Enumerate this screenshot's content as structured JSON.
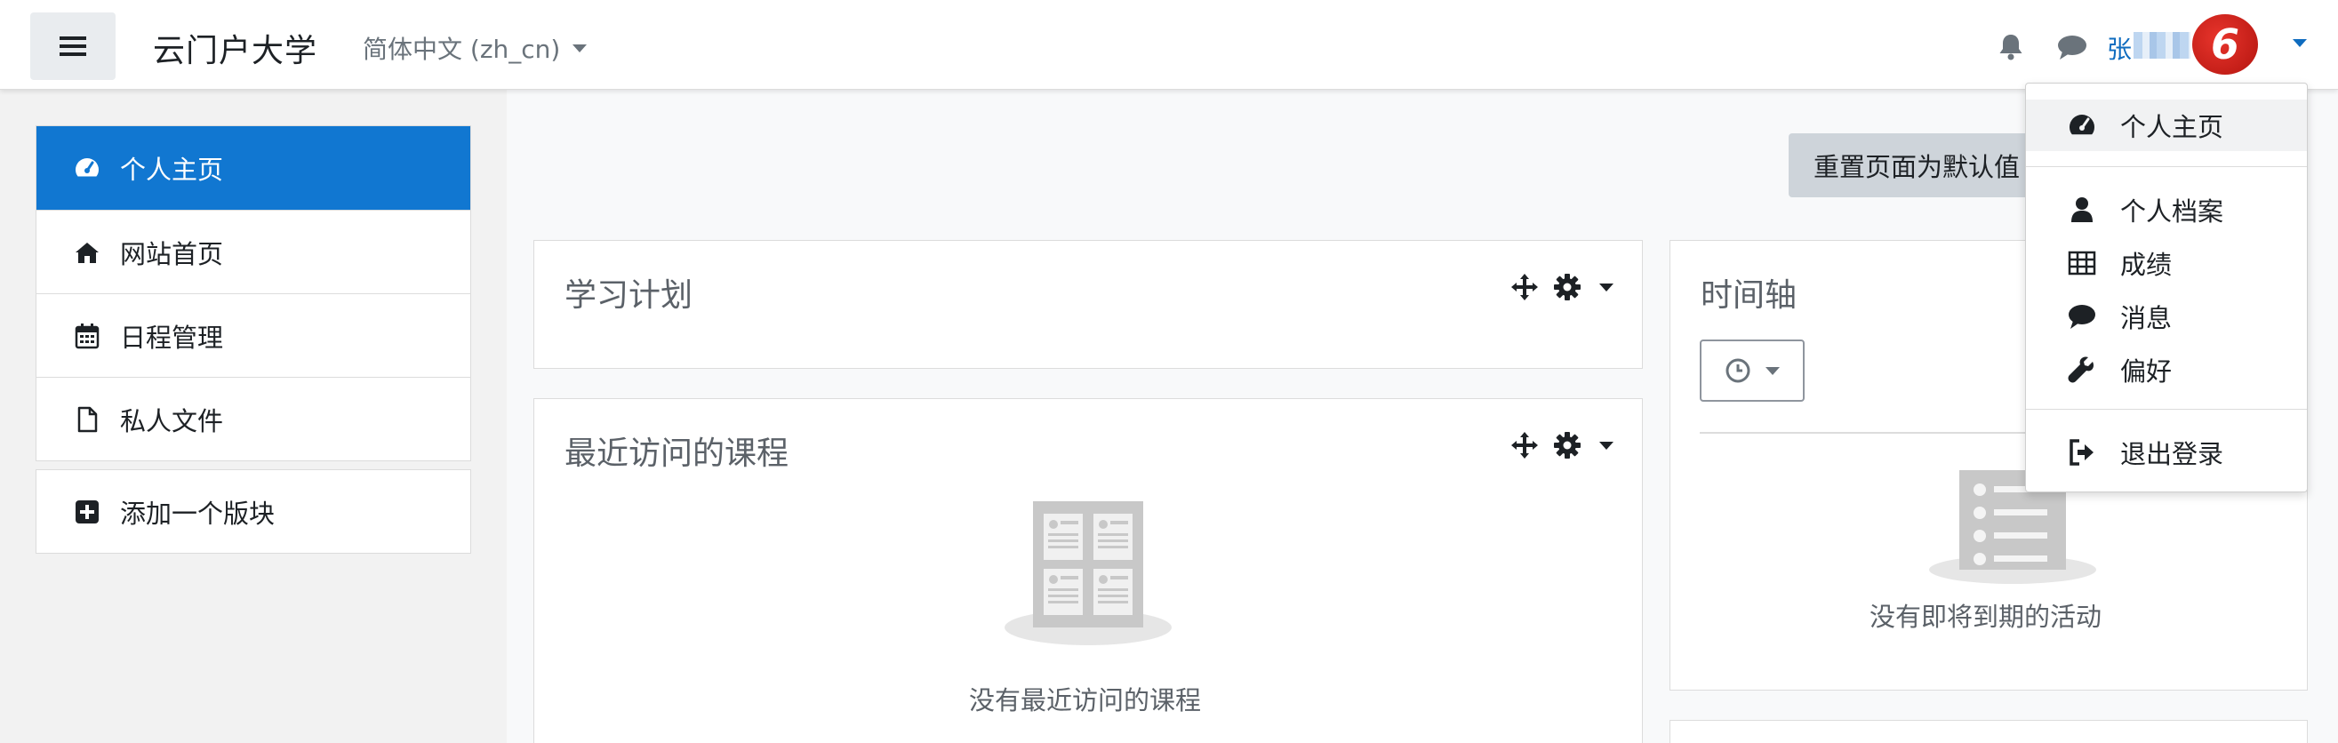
{
  "navbar": {
    "site_name": "云门户大学",
    "language": "简体中文 (zh_cn)",
    "username": "张",
    "avatar_mark": "6"
  },
  "sidebar": {
    "items": [
      {
        "label": "个人主页",
        "icon": "dashboard-icon",
        "active": true
      },
      {
        "label": "网站首页",
        "icon": "home-icon",
        "active": false
      },
      {
        "label": "日程管理",
        "icon": "calendar-icon",
        "active": false
      },
      {
        "label": "私人文件",
        "icon": "file-icon",
        "active": false
      }
    ],
    "add_block_label": "添加一个版块"
  },
  "main": {
    "reset_button_label": "重置页面为默认值",
    "blocks": {
      "study_plan": {
        "title": "学习计划"
      },
      "recent_courses": {
        "title": "最近访问的课程",
        "empty_text": "没有最近访问的课程"
      },
      "timeline": {
        "title": "时间轴",
        "empty_text": "没有即将到期的活动"
      }
    }
  },
  "user_menu": {
    "items": [
      {
        "label": "个人主页",
        "icon": "dashboard-icon"
      },
      {
        "label": "个人档案",
        "icon": "user-icon"
      },
      {
        "label": "成绩",
        "icon": "table-icon"
      },
      {
        "label": "消息",
        "icon": "comment-icon"
      },
      {
        "label": "偏好",
        "icon": "wrench-icon"
      },
      {
        "label": "退出登录",
        "icon": "sign-out-icon"
      }
    ]
  },
  "colors": {
    "accent": "#1177d1",
    "link": "#0f6cbf",
    "muted_text": "#5b6168"
  }
}
